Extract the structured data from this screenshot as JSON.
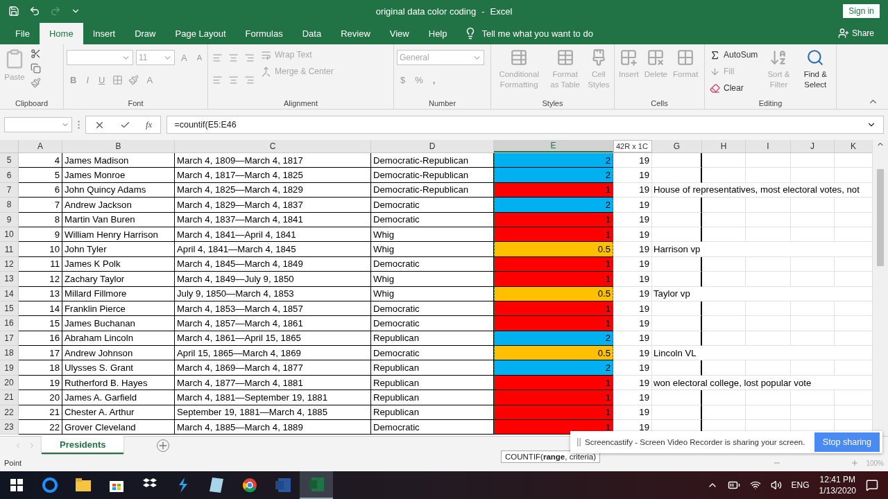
{
  "title_bar": {
    "document": "original data color coding",
    "separator": "-",
    "app": "Excel",
    "sign_in": "Sign in"
  },
  "tabs": [
    {
      "label": "File",
      "selected": false
    },
    {
      "label": "Home",
      "selected": true
    },
    {
      "label": "Insert",
      "selected": false
    },
    {
      "label": "Draw",
      "selected": false
    },
    {
      "label": "Page Layout",
      "selected": false
    },
    {
      "label": "Formulas",
      "selected": false
    },
    {
      "label": "Data",
      "selected": false
    },
    {
      "label": "Review",
      "selected": false
    },
    {
      "label": "View",
      "selected": false
    },
    {
      "label": "Help",
      "selected": false
    }
  ],
  "tell_me": {
    "placeholder": "Tell me what you want to do"
  },
  "share": "Share",
  "ribbon": {
    "clipboard": {
      "label": "Clipboard",
      "paste": {
        "label": "Paste",
        "disabled": true
      }
    },
    "font": {
      "label": "Font",
      "font_name": {
        "disabled": true
      },
      "font_size": {
        "value": "11",
        "disabled": true
      },
      "bold": "B",
      "italic": "I",
      "underline": "U",
      "grow": "A",
      "shrink": "A",
      "text_letter": "A"
    },
    "alignment": {
      "label": "Alignment",
      "wrap": {
        "label": "Wrap Text",
        "disabled": true
      },
      "merge": {
        "label": "Merge & Center",
        "disabled": true
      }
    },
    "number": {
      "label": "Number",
      "format": {
        "value": "General",
        "disabled": true
      },
      "currency": "$",
      "percent": "%",
      "comma": ","
    },
    "styles": {
      "label": "Styles",
      "items": [
        {
          "label": "Conditional Formatting",
          "disabled": true
        },
        {
          "label": "Format as Table",
          "disabled": true
        },
        {
          "label": "Cell Styles",
          "disabled": true
        }
      ]
    },
    "cells": {
      "label": "Cells",
      "items": [
        {
          "label": "Insert",
          "disabled": true
        },
        {
          "label": "Delete",
          "disabled": true
        },
        {
          "label": "Format",
          "disabled": true
        }
      ]
    },
    "editing": {
      "label": "Editing",
      "small": [
        {
          "label": "AutoSum",
          "disabled": false
        },
        {
          "label": "Fill",
          "disabled": true
        },
        {
          "label": "Clear",
          "disabled": false
        }
      ],
      "large": [
        {
          "label": "Sort & Filter",
          "disabled": true
        },
        {
          "label": "Find & Select",
          "disabled": false
        }
      ]
    }
  },
  "formula_bar": {
    "fx": "fx",
    "formula": "=countif(E5:E46"
  },
  "columns": [
    {
      "label": "A",
      "selected": false
    },
    {
      "label": "B",
      "selected": false
    },
    {
      "label": "C",
      "selected": false
    },
    {
      "label": "D",
      "selected": false
    },
    {
      "label": "E",
      "selected": true
    },
    {
      "label": "G",
      "selected": false
    },
    {
      "label": "H",
      "selected": false
    },
    {
      "label": "I",
      "selected": false
    },
    {
      "label": "J",
      "selected": false
    },
    {
      "label": "K",
      "selected": false
    }
  ],
  "selection_size": "42R x 1C",
  "rows": [
    {
      "row": "5",
      "a": "4",
      "b": "James Madison",
      "c": "March 4, 1809—March 4, 1817",
      "d": "Democratic-Republican",
      "e": "2",
      "color": "#00b0f0",
      "f": "19"
    },
    {
      "row": "6",
      "a": "5",
      "b": "James Monroe",
      "c": "March 4, 1817—March 4, 1825",
      "d": "Democratic-Republican",
      "e": "2",
      "color": "#00b0f0",
      "f": "19"
    },
    {
      "row": "7",
      "a": "6",
      "b": "John Quincy Adams",
      "c": "March 4, 1825—March 4, 1829",
      "d": "Democratic-Republican",
      "e": "1",
      "color": "#ff0000",
      "f": "19",
      "g": "House of representatives, most electoral votes, not"
    },
    {
      "row": "8",
      "a": "7",
      "b": "Andrew Jackson",
      "c": "March 4, 1829—March 4, 1837",
      "d": "Democratic",
      "e": "2",
      "color": "#00b0f0",
      "f": "19"
    },
    {
      "row": "9",
      "a": "8",
      "b": "Martin Van Buren",
      "c": "March 4, 1837—March 4, 1841",
      "d": "Democratic",
      "e": "1",
      "color": "#ff0000",
      "f": "19"
    },
    {
      "row": "10",
      "a": "9",
      "b": "William Henry Harrison",
      "c": "March 4, 1841—April 4, 1841",
      "d": "Whig",
      "e": "1",
      "color": "#ff0000",
      "f": "19"
    },
    {
      "row": "11",
      "a": "10",
      "b": "John Tyler",
      "c": "April 4, 1841—March 4, 1845",
      "d": "Whig",
      "e": "0.5",
      "color": "#ffc000",
      "f": "19",
      "g": "Harrison vp"
    },
    {
      "row": "12",
      "a": "11",
      "b": "James K Polk",
      "c": "March 4, 1845—March 4, 1849",
      "d": "Democratic",
      "e": "1",
      "color": "#ff0000",
      "f": "19"
    },
    {
      "row": "13",
      "a": "12",
      "b": "Zachary Taylor",
      "c": "March 4, 1849—July 9, 1850",
      "d": "Whig",
      "e": "1",
      "color": "#ff0000",
      "f": "19"
    },
    {
      "row": "14",
      "a": "13",
      "b": "Millard Fillmore",
      "c": "July 9, 1850—March 4, 1853",
      "d": "Whig",
      "e": "0.5",
      "color": "#ffc000",
      "f": "19",
      "g": "Taylor vp"
    },
    {
      "row": "15",
      "a": "14",
      "b": "Franklin Pierce",
      "c": "March 4, 1853—March 4, 1857",
      "d": "Democratic",
      "e": "1",
      "color": "#ff0000",
      "f": "19"
    },
    {
      "row": "16",
      "a": "15",
      "b": "James Buchanan",
      "c": "March 4, 1857—March 4, 1861",
      "d": "Democratic",
      "e": "1",
      "color": "#ff0000",
      "f": "19"
    },
    {
      "row": "17",
      "a": "16",
      "b": "Abraham Lincoln",
      "c": "March 4, 1861—April 15, 1865",
      "d": "Republican",
      "e": "2",
      "color": "#00b0f0",
      "f": "19"
    },
    {
      "row": "18",
      "a": "17",
      "b": "Andrew Johnson",
      "c": "April 15, 1865—March 4, 1869",
      "d": "Democratic",
      "e": "0.5",
      "color": "#ffc000",
      "f": "19",
      "g": "Lincoln VL"
    },
    {
      "row": "19",
      "a": "18",
      "b": "Ulysses S. Grant",
      "c": "March 4, 1869—March 4, 1877",
      "d": "Republican",
      "e": "2",
      "color": "#00b0f0",
      "f": "19"
    },
    {
      "row": "20",
      "a": "19",
      "b": "Rutherford B. Hayes",
      "c": "March 4, 1877—March 4, 1881",
      "d": "Republican",
      "e": "1",
      "color": "#ff0000",
      "f": "19",
      "g": "won electoral college, lost popular vote"
    },
    {
      "row": "21",
      "a": "20",
      "b": "James A. Garfield",
      "c": "March 4, 1881—September 19, 1881",
      "d": "Republican",
      "e": "1",
      "color": "#ff0000",
      "f": "19"
    },
    {
      "row": "22",
      "a": "21",
      "b": "Chester A. Arthur",
      "c": "September 19, 1881—March 4, 1885",
      "d": "Republican",
      "e": "1",
      "color": "#ff0000",
      "f": "19"
    },
    {
      "row": "23",
      "a": "22",
      "b": "Grover Cleveland",
      "c": "March 4, 1885—March 4, 1889",
      "d": "Democratic",
      "e": "1",
      "color": "#ff0000",
      "f": "19"
    }
  ],
  "sheet_tabs": [
    {
      "label": "Presidents",
      "selected": true
    }
  ],
  "function_tooltip": "COUNTIF(**range**, criteria)",
  "notification": {
    "text": "Screencastify - Screen Video Recorder is sharing your screen.",
    "button": "Stop sharing"
  },
  "status_bar": {
    "mode": "Point",
    "zoom": "100%"
  },
  "taskbar": {
    "language": "ENG",
    "time": "12:41 PM",
    "date": "1/13/2020"
  }
}
